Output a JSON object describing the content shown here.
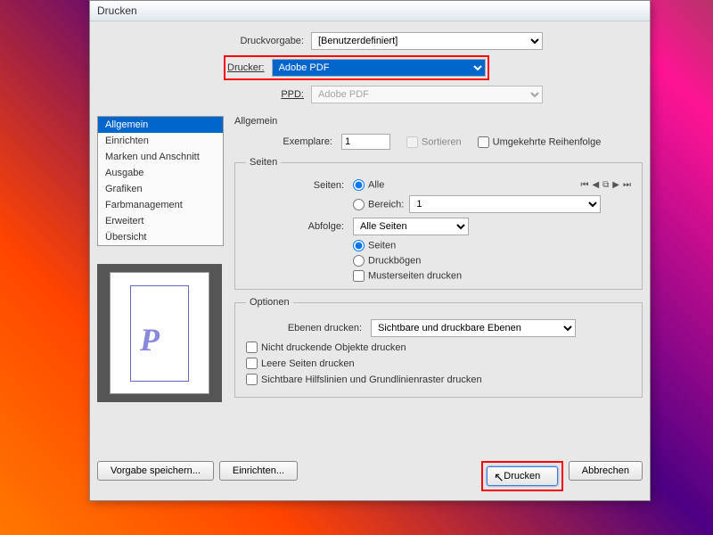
{
  "title": "Drucken",
  "top": {
    "preset_label": "Druckvorgabe:",
    "preset_value": "[Benutzerdefiniert]",
    "printer_label": "Drucker:",
    "printer_value": "Adobe PDF",
    "ppd_label": "PPD:",
    "ppd_value": "Adobe PDF"
  },
  "sidebar": [
    "Allgemein",
    "Einrichten",
    "Marken und Anschnitt",
    "Ausgabe",
    "Grafiken",
    "Farbmanagement",
    "Erweitert",
    "Übersicht"
  ],
  "general": {
    "heading": "Allgemein",
    "copies_label": "Exemplare:",
    "copies_value": "1",
    "collate": "Sortieren",
    "reverse": "Umgekehrte Reihenfolge",
    "pages_legend": "Seiten",
    "pages_label": "Seiten:",
    "all": "Alle",
    "range_label": "Bereich:",
    "range_value": "1",
    "sequence_label": "Abfolge:",
    "sequence_value": "Alle Seiten",
    "opt_pages": "Seiten",
    "opt_spreads": "Druckbögen",
    "opt_master": "Musterseiten drucken",
    "options_legend": "Optionen",
    "layers_label": "Ebenen drucken:",
    "layers_value": "Sichtbare und druckbare Ebenen",
    "nonprinting": "Nicht druckende Objekte drucken",
    "blank": "Leere Seiten drucken",
    "guides": "Sichtbare Hilfslinien und Grundlinienraster drucken"
  },
  "buttons": {
    "save_preset": "Vorgabe speichern...",
    "setup": "Einrichten...",
    "print": "Drucken",
    "cancel": "Abbrechen"
  }
}
